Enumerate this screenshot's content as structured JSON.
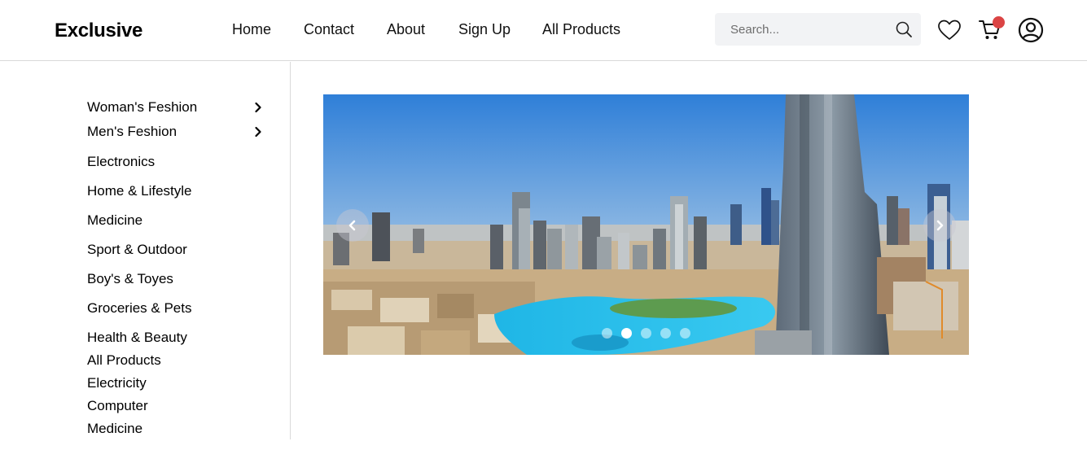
{
  "header": {
    "logo": "Exclusive",
    "nav": [
      {
        "label": "Home"
      },
      {
        "label": "Contact"
      },
      {
        "label": "About"
      },
      {
        "label": "Sign Up"
      },
      {
        "label": "All Products"
      }
    ],
    "search": {
      "placeholder": "Search...",
      "value": ""
    },
    "icons": [
      "search-icon",
      "heart-icon",
      "cart-icon",
      "user-icon"
    ],
    "cart_badge_color": "#db4444"
  },
  "sidebar": {
    "categories": [
      {
        "label": "Woman's Feshion",
        "has_submenu": true
      },
      {
        "label": "Men's Feshion",
        "has_submenu": true
      },
      {
        "label": "Electronics",
        "has_submenu": false
      },
      {
        "label": "Home & Lifestyle",
        "has_submenu": false
      },
      {
        "label": "Medicine",
        "has_submenu": false
      },
      {
        "label": "Sport & Outdoor",
        "has_submenu": false
      },
      {
        "label": "Boy's & Toyes",
        "has_submenu": false
      },
      {
        "label": "Groceries & Pets",
        "has_submenu": false
      },
      {
        "label": "Health & Beauty",
        "has_submenu": false
      },
      {
        "label": "All Products",
        "has_submenu": false
      },
      {
        "label": "Electricity",
        "has_submenu": false
      },
      {
        "label": "Computer",
        "has_submenu": false
      },
      {
        "label": "Medicine",
        "has_submenu": false
      }
    ]
  },
  "slider": {
    "image": "city-skyline-photo",
    "dot_count": 5,
    "active_index": 1,
    "icons": [
      "chevron-left-icon",
      "chevron-right-icon"
    ]
  },
  "colors": {
    "accent": "#db4444",
    "divider": "#d9d9d9",
    "search_bg": "#f2f3f5"
  }
}
